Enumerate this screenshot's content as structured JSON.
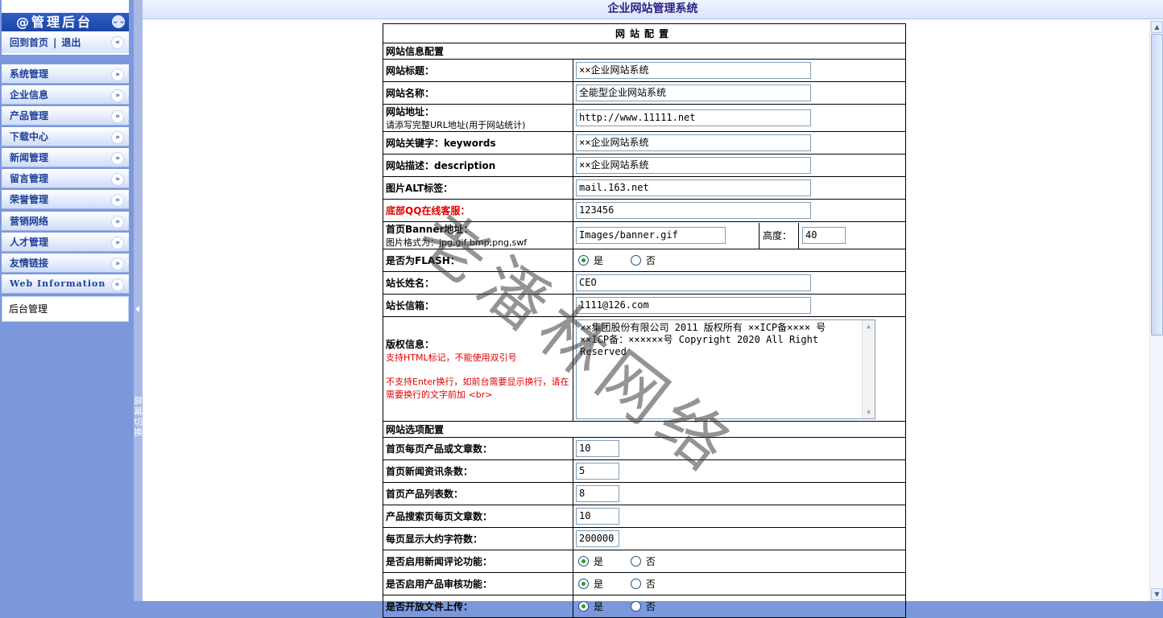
{
  "app_title": "企业网站管理系统",
  "sidebar": {
    "brand": "@管理后台",
    "home_label": "回到首页",
    "separator": "|",
    "logout_label": "退出",
    "menu": [
      {
        "label": "系统管理"
      },
      {
        "label": "企业信息"
      },
      {
        "label": "产品管理"
      },
      {
        "label": "下载中心"
      },
      {
        "label": "新闻管理"
      },
      {
        "label": "留言管理"
      },
      {
        "label": "荣誉管理"
      },
      {
        "label": "营销网络"
      },
      {
        "label": "人才管理"
      },
      {
        "label": "友情链接"
      },
      {
        "label": "Web Information"
      }
    ],
    "sub_item": "后台管理",
    "splitter_label": "屏幕切换"
  },
  "config": {
    "header": "网站配置",
    "section_info": "网站信息配置",
    "site_title_label": "网站标题：",
    "site_title_value": "××企业网站系统",
    "site_name_label": "网站名称：",
    "site_name_value": "全能型企业网站系统",
    "site_url_label": "网站地址：",
    "site_url_note": "请添写完整URL地址(用于网站统计)",
    "site_url_value": "http://www.11111.net",
    "keywords_label": "网站关键字：keywords",
    "keywords_value": "××企业网站系统",
    "description_label": "网站描述：description",
    "description_value": "××企业网站系统",
    "alt_label": "图片ALT标签：",
    "alt_value": "mail.163.net",
    "qq_label": "底部QQ在线客服：",
    "qq_value": "123456",
    "banner_label": "首页Banner地址：",
    "banner_note": "图片格式为：jpg,gif,bmp,png,swf",
    "banner_value": "Images/banner.gif",
    "height_label": "高度：",
    "height_value": "40",
    "flash_label": "是否为FLASH：",
    "yes": "是",
    "no": "否",
    "owner_label": "站长姓名：",
    "owner_value": "CEO",
    "email_label": "站长信箱：",
    "email_value": "1111@126.com",
    "copyright_label": "版权信息：",
    "copyright_note1": "支持HTML标记，不能使用双引号",
    "copyright_note2": "不支持Enter换行，如前台需要显示换行，请在需要换行的文字前加 <br>",
    "copyright_value": "××集团股份有限公司 2011 版权所有 ××ICP备×××× 号 ××ICP备：××××××号  Copyright 2020   All Right Reserved",
    "section_options": "网站选项配置",
    "home_products_label": "首页每页产品或文章数：",
    "home_products_value": "10",
    "home_news_label": "首页新闻资讯条数：",
    "home_news_value": "5",
    "home_product_list_label": "首页产品列表数：",
    "home_product_list_value": "8",
    "search_per_page_label": "产品搜索页每页文章数：",
    "search_per_page_value": "10",
    "max_chars_label": "每页显示大约字符数：",
    "max_chars_value": "200000",
    "news_comment_label": "是否启用新闻评论功能：",
    "product_audit_label": "是否启用产品审核功能：",
    "file_upload_label": "是否开放文件上传："
  },
  "watermark": "老潘林网络"
}
